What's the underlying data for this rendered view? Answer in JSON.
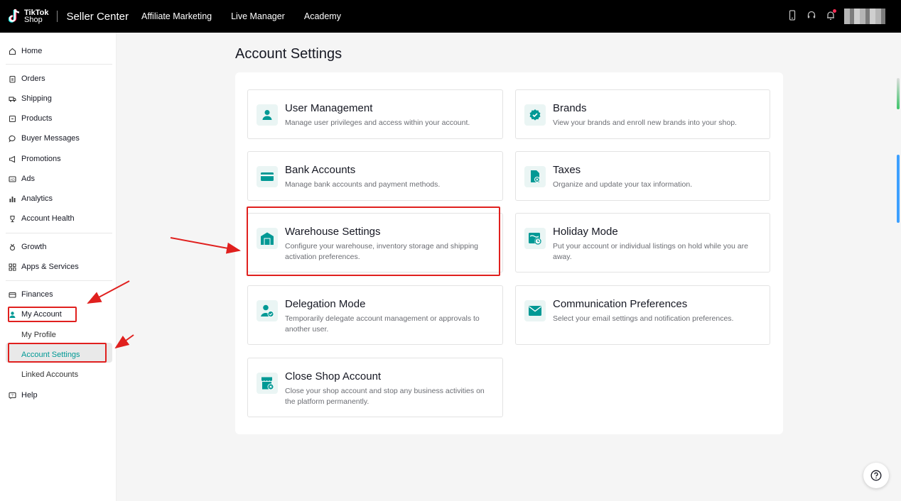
{
  "topbar": {
    "logo_line1": "TikTok",
    "logo_line2": "Shop",
    "title": "Seller Center",
    "nav": [
      "Affiliate Marketing",
      "Live Manager",
      "Academy"
    ],
    "icons": [
      "phone-icon",
      "headset-icon",
      "bell-icon"
    ]
  },
  "sidebar": {
    "items": [
      {
        "label": "Home",
        "icon": "home-icon"
      },
      {
        "label": "Orders",
        "icon": "clipboard-icon"
      },
      {
        "label": "Shipping",
        "icon": "truck-icon"
      },
      {
        "label": "Products",
        "icon": "box-icon"
      },
      {
        "label": "Buyer Messages",
        "icon": "chat-icon"
      },
      {
        "label": "Promotions",
        "icon": "megaphone-icon"
      },
      {
        "label": "Ads",
        "icon": "ads-icon"
      },
      {
        "label": "Analytics",
        "icon": "bar-chart-icon"
      },
      {
        "label": "Account Health",
        "icon": "trophy-icon"
      },
      {
        "label": "Growth",
        "icon": "medal-icon"
      },
      {
        "label": "Apps & Services",
        "icon": "grid-icon"
      },
      {
        "label": "Finances",
        "icon": "card-icon"
      },
      {
        "label": "My Account",
        "icon": "user-icon"
      },
      {
        "label": "Help",
        "icon": "help-chat-icon"
      }
    ],
    "sub_items": [
      "My Profile",
      "Account Settings",
      "Linked Accounts"
    ]
  },
  "main": {
    "title": "Account Settings",
    "cards": [
      {
        "title": "User Management",
        "desc": "Manage user privileges and access within your account.",
        "icon": "person-icon"
      },
      {
        "title": "Brands",
        "desc": "View your brands and enroll new brands into your shop.",
        "icon": "verified-badge-icon"
      },
      {
        "title": "Bank Accounts",
        "desc": "Manage bank accounts and payment methods.",
        "icon": "bank-card-icon"
      },
      {
        "title": "Taxes",
        "desc": "Organize and update your tax information.",
        "icon": "tax-document-icon"
      },
      {
        "title": "Warehouse Settings",
        "desc": "Configure your warehouse, inventory storage and shipping activation preferences.",
        "icon": "warehouse-icon"
      },
      {
        "title": "Holiday Mode",
        "desc": "Put your account or individual listings on hold while you are away.",
        "icon": "holiday-clock-icon"
      },
      {
        "title": "Delegation Mode",
        "desc": "Temporarily delegate account management or approvals to another user.",
        "icon": "delegate-user-icon"
      },
      {
        "title": "Communication Preferences",
        "desc": "Select your email settings and notification preferences.",
        "icon": "envelope-icon"
      },
      {
        "title": "Close Shop Account",
        "desc": "Close your shop account and stop any business activities on the platform permanently.",
        "icon": "close-shop-icon"
      }
    ]
  },
  "colors": {
    "accent": "#009995",
    "annotation": "#e0201e",
    "topbar": "#000000"
  }
}
